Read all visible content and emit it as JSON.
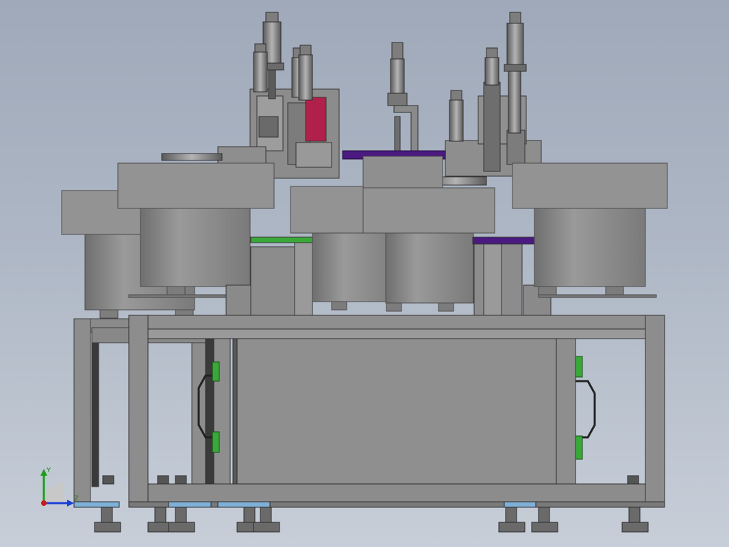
{
  "window": {
    "title": ""
  },
  "triad": {
    "y_label": "Y",
    "z_label": "Z",
    "colors": {
      "y": "#19a019",
      "z": "#1a3fd6",
      "x": "#d01818"
    }
  },
  "colors": {
    "frame": "#8d8d8d",
    "frame_dark": "#4a4a4a",
    "bowl": "#8a8a8a",
    "bowl_top": "#939393",
    "panel": "#8f8f8f",
    "accent_magenta": "#b0204a",
    "accent_purple": "#4a1a80",
    "accent_green": "#39a839",
    "foot_blue": "#7fb0d8"
  }
}
